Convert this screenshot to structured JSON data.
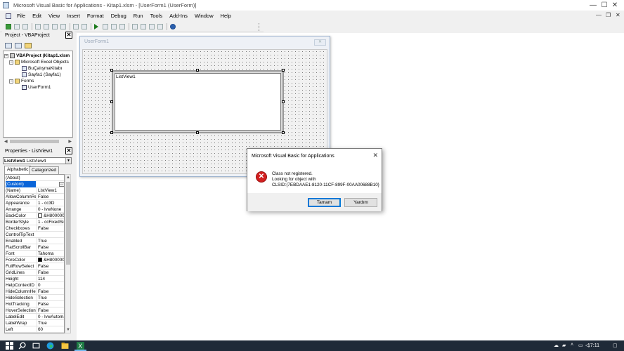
{
  "window": {
    "title": "Microsoft Visual Basic for Applications - Kitap1.xlsm - [UserForm1 (UserForm)]",
    "minimize": "—",
    "maximize": "☐",
    "close": "✕"
  },
  "menu": [
    "File",
    "Edit",
    "View",
    "Insert",
    "Format",
    "Debug",
    "Run",
    "Tools",
    "Add-Ins",
    "Window",
    "Help"
  ],
  "mdi_controls": {
    "minimize": "—",
    "restore": "❐",
    "close": "✕"
  },
  "project": {
    "title": "Project - VBAProject",
    "close": "✕",
    "tree": [
      {
        "label": "VBAProject (Kitap1.xlsm",
        "icon": "vba-project-icon"
      },
      {
        "label": "Microsoft Excel Objects",
        "icon": "folder-icon"
      },
      {
        "label": "BuÇalışmaKitabı",
        "icon": "workbook-icon"
      },
      {
        "label": "Sayfa1 (Sayfa1)",
        "icon": "worksheet-icon"
      },
      {
        "label": "Forms",
        "icon": "folder-icon"
      },
      {
        "label": "UserForm1",
        "icon": "userform-icon"
      }
    ]
  },
  "properties": {
    "title": "Properties - ListView1",
    "close": "✕",
    "object_name": "ListView1",
    "object_type": "ListView4",
    "tabs": [
      "Alphabetic",
      "Categorized"
    ],
    "rows": [
      {
        "name": "(About)",
        "value": ""
      },
      {
        "name": "(Custom)",
        "value": "",
        "button": "..."
      },
      {
        "name": "(Name)",
        "value": "ListView1"
      },
      {
        "name": "AllowColumnReorder",
        "value": "False"
      },
      {
        "name": "Appearance",
        "value": "1 - cc3D"
      },
      {
        "name": "Arrange",
        "value": "0 - lvwNone"
      },
      {
        "name": "BackColor",
        "value": "&H8000000",
        "swatch": "#ffffff"
      },
      {
        "name": "BorderStyle",
        "value": "1 - ccFixedSingle"
      },
      {
        "name": "Checkboxes",
        "value": "False"
      },
      {
        "name": "ControlTipText",
        "value": ""
      },
      {
        "name": "Enabled",
        "value": "True"
      },
      {
        "name": "FlatScrollBar",
        "value": "False"
      },
      {
        "name": "Font",
        "value": "Tahoma"
      },
      {
        "name": "ForeColor",
        "value": "&H8000000",
        "swatch": "#000000"
      },
      {
        "name": "FullRowSelect",
        "value": "False"
      },
      {
        "name": "GridLines",
        "value": "False"
      },
      {
        "name": "Height",
        "value": "114"
      },
      {
        "name": "HelpContextID",
        "value": "0"
      },
      {
        "name": "HideColumnHeaders",
        "value": "False"
      },
      {
        "name": "HideSelection",
        "value": "True"
      },
      {
        "name": "HotTracking",
        "value": "False"
      },
      {
        "name": "HoverSelection",
        "value": "False"
      },
      {
        "name": "LabelEdit",
        "value": "0 - lvwAutomatic"
      },
      {
        "name": "LabelWrap",
        "value": "True"
      },
      {
        "name": "Left",
        "value": "60"
      }
    ]
  },
  "designer": {
    "title": "UserForm1",
    "close": "✕",
    "listview_label": "ListView1"
  },
  "dialog": {
    "title": "Microsoft Visual Basic for Applications",
    "close": "✕",
    "icon": "error-icon",
    "message_line1": "Class not registered.",
    "message_line2": "Looking for object with",
    "message_line3": "CLSID:{7EBDAAE1-8120-11CF-899F-00AA00688B10}",
    "ok_button": "Tamam",
    "help_button": "Yardım"
  },
  "taskbar": {
    "time": "17:11"
  }
}
